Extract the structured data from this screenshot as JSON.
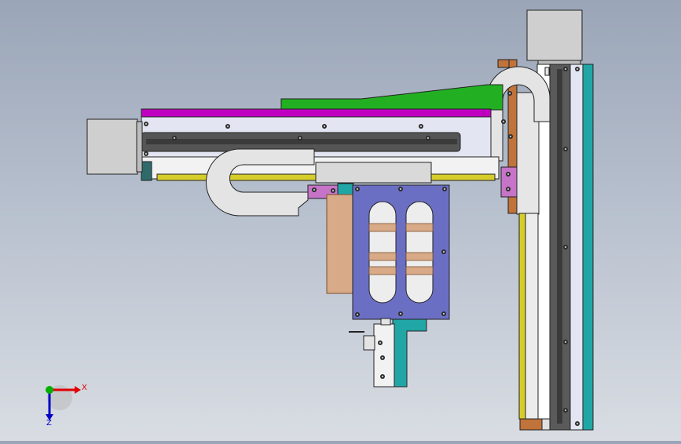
{
  "view": {
    "background_top": "#9aa5b7",
    "background_bottom": "#d9dde3"
  },
  "palette": {
    "motor_gray": "#cfcfcf",
    "rail_dark": "#4d4d4d",
    "plate_light": "#e3e6f2",
    "magenta": "#c000c0",
    "green": "#22b022",
    "yellow_strip": "#d6cd2a",
    "carriage_blue": "#6b6fc4",
    "pink_block": "#c674c8",
    "cyan": "#21a6a6",
    "brown": "#c0733a",
    "finger_tan": "#d8aa87"
  },
  "triad": {
    "x_label": "X",
    "y_label": "Y",
    "z_label": "Z",
    "x_color": "#e00000",
    "y_color": "#00b000",
    "z_color": "#0000c8"
  }
}
